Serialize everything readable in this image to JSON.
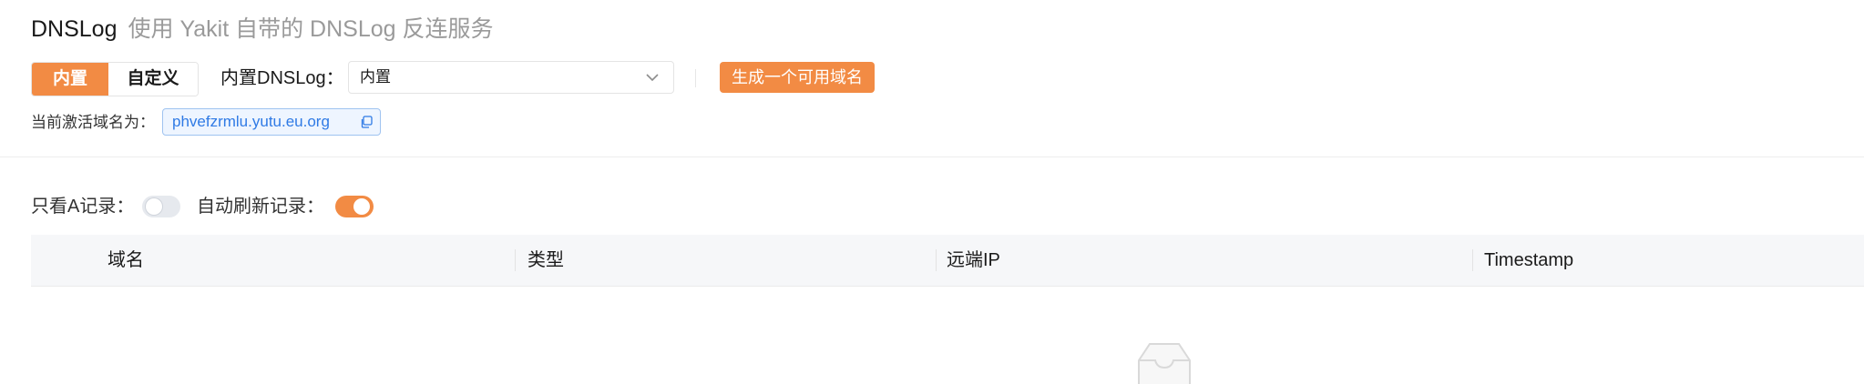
{
  "header": {
    "title": "DNSLog",
    "subtitle": "使用 Yakit 自带的 DNSLog 反连服务"
  },
  "mode_toggle": {
    "options": [
      {
        "label": "内置",
        "active": true
      },
      {
        "label": "自定义",
        "active": false
      }
    ]
  },
  "builtin_dnslog": {
    "label": "内置DNSLog：",
    "selected": "内置"
  },
  "generate_button": {
    "label": "生成一个可用域名"
  },
  "current_domain": {
    "label": "当前激活域名为：",
    "value": "phvefzrmlu.yutu.eu.org"
  },
  "filters": {
    "only_a_records": {
      "label": "只看A记录：",
      "enabled": false
    },
    "auto_refresh": {
      "label": "自动刷新记录：",
      "enabled": true
    }
  },
  "table": {
    "columns": [
      "域名",
      "类型",
      "远端IP",
      "Timestamp"
    ]
  },
  "colors": {
    "accent": "#f28b44",
    "link": "#2f7ae5",
    "muted_text": "#9a9a9a"
  },
  "icons": [
    "chevron-down-icon",
    "copy-icon",
    "empty-box-icon"
  ]
}
